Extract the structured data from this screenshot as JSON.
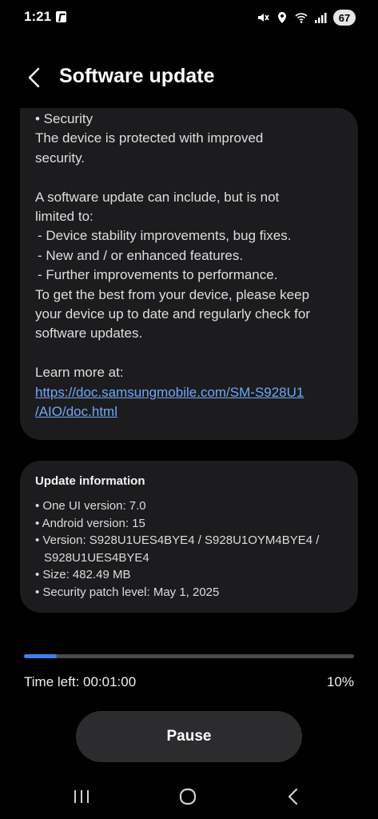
{
  "status_bar": {
    "time": "1:21",
    "battery": "67",
    "icons": [
      "nfc-icon",
      "mute-icon",
      "location-icon",
      "wifi-6-icon",
      "signal-icon",
      "battery-icon"
    ]
  },
  "header": {
    "title": "Software update",
    "back_icon": "chevron-left-icon"
  },
  "release_notes": {
    "lines": [
      "• Security",
      "The device is protected with improved",
      "security.",
      "",
      "A software update can include, but is not",
      "limited to:",
      " - Device stability improvements, bug fixes.",
      " - New and / or enhanced features.",
      " - Further improvements to performance.",
      "To get the best from your device, please keep",
      "your device up to date and regularly check for",
      "software updates.",
      "",
      "Learn more at:"
    ],
    "link_line1": "https://doc.samsungmobile.com/SM-S928U1",
    "link_line2": "/AIO/doc.html"
  },
  "update_info": {
    "title": "Update information",
    "one_ui": "• One UI version: 7.0",
    "android": "• Android version: 15",
    "version_line1": "• Version: S928U1UES4BYE4 / S928U1OYM4BYE4 /",
    "version_line2": "S928U1UES4BYE4",
    "size": "• Size: 482.49 MB",
    "security_patch": "• Security patch level: May 1, 2025"
  },
  "progress": {
    "fraction": 0.1,
    "time_left": "Time left: 00:01:00",
    "percent_label": "10%"
  },
  "actions": {
    "pause_label": "Pause"
  },
  "nav_bar": {
    "items": [
      "recents-icon",
      "home-icon",
      "back-icon"
    ]
  },
  "colors": {
    "background": "#000000",
    "card": "#1c1c1e",
    "accent": "#3b82f0",
    "link": "#6ea8f7",
    "button": "#2c2c2e"
  }
}
